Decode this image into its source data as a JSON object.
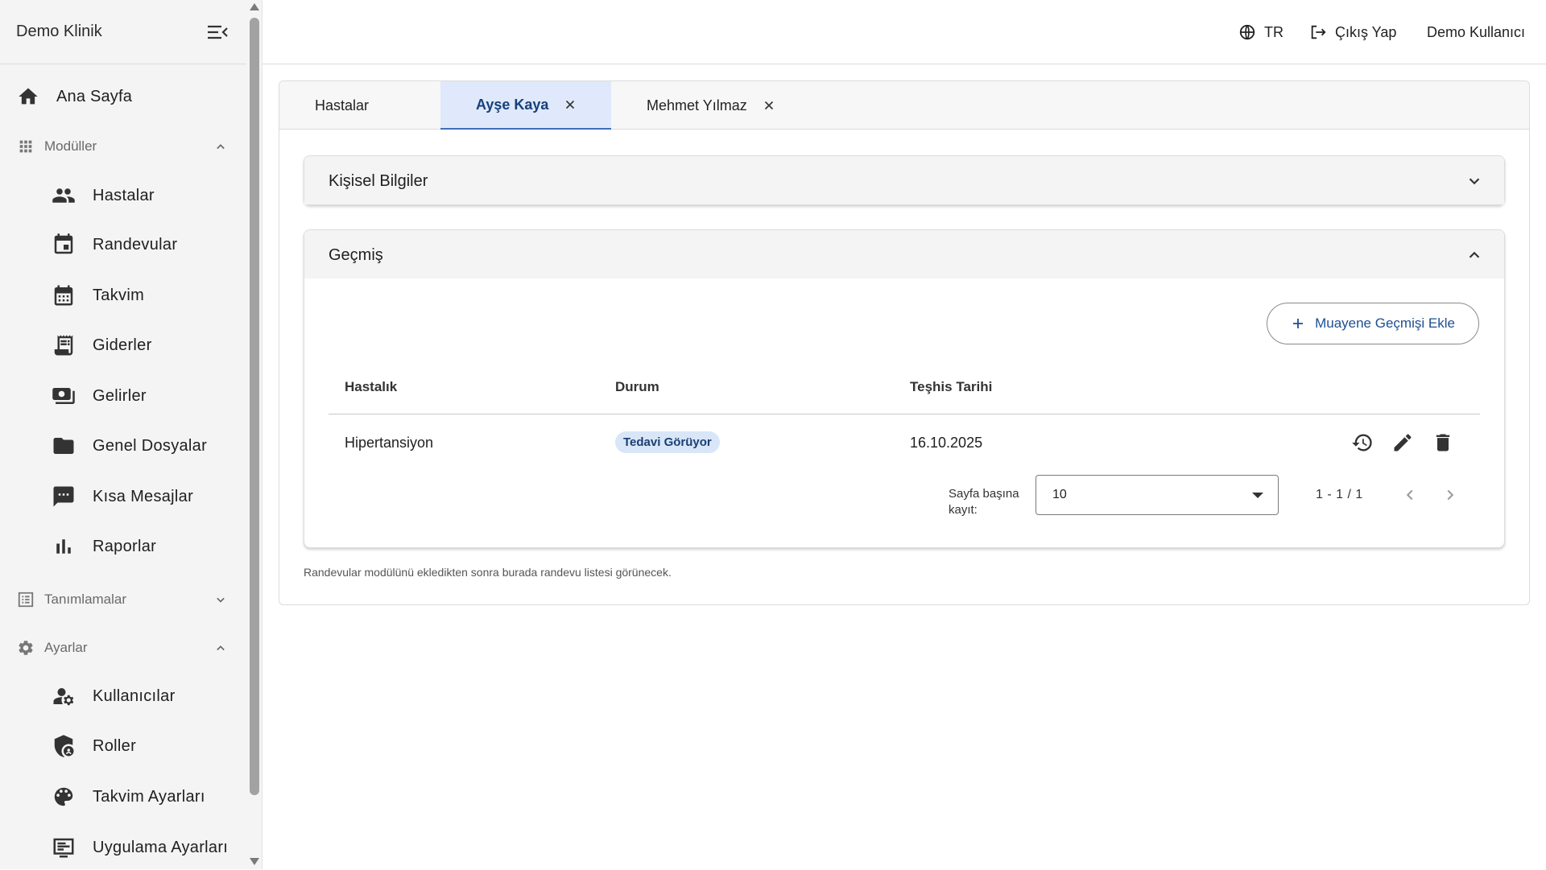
{
  "sidebar": {
    "brand": "Demo Klinik",
    "home": {
      "label": "Ana Sayfa",
      "icon": "home-icon"
    },
    "groups": {
      "modules": {
        "label": "Modüller",
        "icon": "apps-grid-icon",
        "expanded": true
      },
      "definitions": {
        "label": "Tanımlamalar",
        "icon": "list-icon",
        "expanded": false
      },
      "settings": {
        "label": "Ayarlar",
        "icon": "gear-icon",
        "expanded": true
      }
    },
    "module_items": [
      {
        "label": "Hastalar",
        "icon": "people-icon"
      },
      {
        "label": "Randevular",
        "icon": "calendar-event-icon"
      },
      {
        "label": "Takvim",
        "icon": "calendar-month-icon"
      },
      {
        "label": "Giderler",
        "icon": "receipt-icon"
      },
      {
        "label": "Gelirler",
        "icon": "payments-icon"
      },
      {
        "label": "Genel Dosyalar",
        "icon": "folder-icon"
      },
      {
        "label": "Kısa Mesajlar",
        "icon": "sms-icon"
      },
      {
        "label": "Raporlar",
        "icon": "bar-chart-icon"
      }
    ],
    "settings_items": [
      {
        "label": "Kullanıcılar",
        "icon": "user-gear-icon"
      },
      {
        "label": "Roller",
        "icon": "shield-lock-icon"
      },
      {
        "label": "Takvim Ayarları",
        "icon": "palette-icon"
      },
      {
        "label": "Uygulama Ayarları",
        "icon": "app-settings-icon"
      }
    ]
  },
  "topbar": {
    "language": "TR",
    "logout": "Çıkış Yap",
    "user": "Demo Kullanıcı"
  },
  "tabs": [
    {
      "label": "Hastalar",
      "closable": false,
      "active": false
    },
    {
      "label": "Ayşe Kaya",
      "closable": true,
      "active": true
    },
    {
      "label": "Mehmet Yılmaz",
      "closable": true,
      "active": false
    }
  ],
  "personal_panel": {
    "title": "Kişisel Bilgiler",
    "expanded": false
  },
  "history_panel": {
    "title": "Geçmiş",
    "expanded": true,
    "add_button": "Muayene Geçmişi Ekle",
    "columns": [
      "Hastalık",
      "Durum",
      "Teşhis Tarihi"
    ],
    "rows": [
      {
        "disease": "Hipertansiyon",
        "status": "Tedavi Görüyor",
        "date": "16.10.2025"
      }
    ],
    "pagination": {
      "per_page_label_1": "Sayfa başına",
      "per_page_label_2": "kayıt:",
      "per_page_value": "10",
      "range": "1 - 1 / 1"
    }
  },
  "footnote": "Randevular modülünü ekledikten sonra burada randevu listesi görünecek.",
  "colors": {
    "accent": "#1d4f91",
    "active_tab_bg": "#dfe9fb",
    "badge_bg": "#d8e6f8",
    "sidebar_bg": "#f4f4f4"
  }
}
